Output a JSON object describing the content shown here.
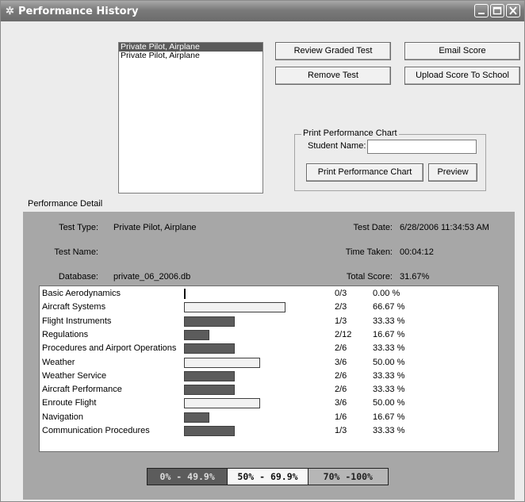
{
  "window": {
    "title": "Performance History",
    "icon": "gear-app-icon",
    "controls": [
      "minimize-icon",
      "maximize-icon",
      "close-icon"
    ]
  },
  "test_list": {
    "items": [
      "Private Pilot, Airplane",
      "Private Pilot, Airplane"
    ],
    "selected_index": 0
  },
  "buttons": {
    "review_graded_test": "Review Graded Test",
    "email_score": "Email Score",
    "remove_test": "Remove Test",
    "upload_score": "Upload Score To School"
  },
  "print_chart": {
    "group_label": "Print Performance Chart",
    "student_name_label": "Student Name:",
    "student_name_value": "",
    "print_button": "Print Performance Chart",
    "preview_button": "Preview"
  },
  "detail": {
    "section_label": "Performance Detail",
    "test_type_label": "Test Type:",
    "test_type_value": "Private Pilot, Airplane",
    "test_name_label": "Test Name:",
    "test_name_value": "",
    "database_label": "Database:",
    "database_value": "private_06_2006.db",
    "test_date_label": "Test Date:",
    "test_date_value": "6/28/2006 11:34:53 AM",
    "time_taken_label": "Time Taken:",
    "time_taken_value": "00:04:12",
    "total_score_label": "Total Score:",
    "total_score_value": "31.67%"
  },
  "results": [
    {
      "category": "Basic Aerodynamics",
      "score": "0/3",
      "percent_text": "0.00 %",
      "percent": 0
    },
    {
      "category": "Aircraft Systems",
      "score": "2/3",
      "percent_text": "66.67 %",
      "percent": 66.67
    },
    {
      "category": "Flight Instruments",
      "score": "1/3",
      "percent_text": "33.33 %",
      "percent": 33.33
    },
    {
      "category": "Regulations",
      "score": "2/12",
      "percent_text": "16.67 %",
      "percent": 16.67
    },
    {
      "category": "Procedures and Airport Operations",
      "score": "2/6",
      "percent_text": "33.33 %",
      "percent": 33.33
    },
    {
      "category": "Weather",
      "score": "3/6",
      "percent_text": "50.00 %",
      "percent": 50
    },
    {
      "category": "Weather Service",
      "score": "2/6",
      "percent_text": "33.33 %",
      "percent": 33.33
    },
    {
      "category": "Aircraft Performance",
      "score": "2/6",
      "percent_text": "33.33 %",
      "percent": 33.33
    },
    {
      "category": "Enroute Flight",
      "score": "3/6",
      "percent_text": "50.00 %",
      "percent": 50
    },
    {
      "category": "Navigation",
      "score": "1/6",
      "percent_text": "16.67 %",
      "percent": 16.67
    },
    {
      "category": "Communication Procedures",
      "score": "1/3",
      "percent_text": "33.33 %",
      "percent": 33.33
    }
  ],
  "legend": {
    "low": "0% - 49.9%",
    "mid": "50% - 69.9%",
    "high": "70% -100%"
  }
}
